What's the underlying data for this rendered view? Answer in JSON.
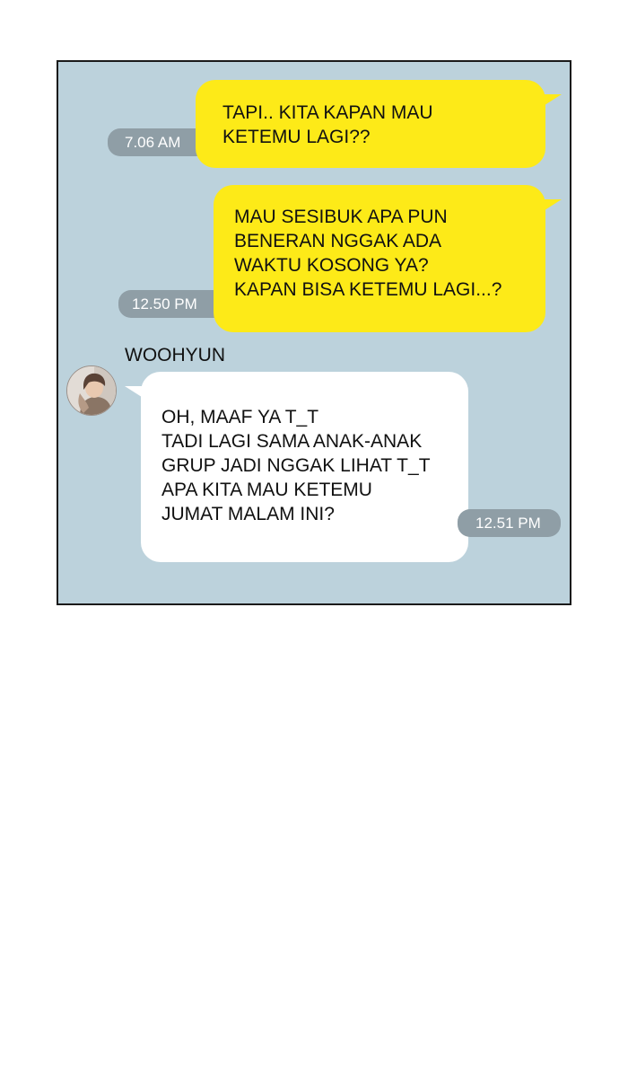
{
  "messages": [
    {
      "type": "outgoing",
      "time": "7.06 AM",
      "lines": [
        "TAPI.. KITA KAPAN MAU",
        "KETEMU LAGI??"
      ]
    },
    {
      "type": "outgoing",
      "time": "12.50 PM",
      "lines": [
        "MAU SESIBUK APA PUN",
        "BENERAN NGGAK ADA",
        "WAKTU KOSONG YA?",
        "KAPAN BISA KETEMU LAGI...?"
      ]
    },
    {
      "type": "incoming",
      "sender": "WOOHYUN",
      "time": "12.51 PM",
      "lines": [
        "OH, MAAF YA T_T",
        "TADI LAGI SAMA ANAK-ANAK",
        "GRUP JADI NGGAK LIHAT T_T",
        "APA KITA MAU KETEMU",
        "JUMAT MALAM INI?"
      ]
    }
  ],
  "colors": {
    "background": "#bcd2dc",
    "outgoing_bubble": "#fdea18",
    "incoming_bubble": "#ffffff",
    "timestamp": "#8f9ea6"
  },
  "icons": {
    "avatar": "avatar-woohyun-icon"
  }
}
